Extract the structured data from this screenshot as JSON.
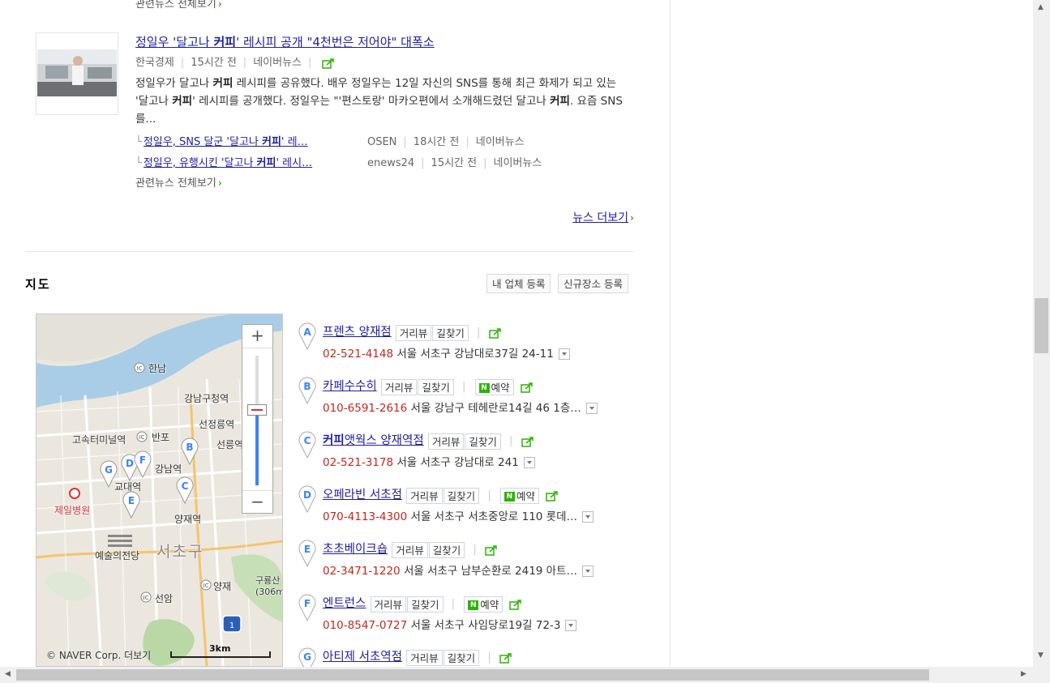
{
  "news": {
    "related_all_top": "관련뉴스 전체보기",
    "item": {
      "title_pre": "정일우 '달고나 ",
      "title_hl": "커피",
      "title_post": "' 레시피 공개 \"4천번은 저어야\" 대폭소",
      "source": "한국경제",
      "time": "15시간 전",
      "portal": "네이버뉴스",
      "desc_1": "정일우가 달고나 ",
      "desc_hl1": "커피",
      "desc_2": " 레시피를 공유했다. 배우 정일우는 12일 자신의 SNS를 통해 최근 화제가 되고 있는 '달고나 ",
      "desc_hl2": "커피",
      "desc_3": "' 레시피를 공개했다. 정일우는 \"'편스토랑' 마카오편에서 소개해드렸던 달고나 ",
      "desc_hl3": "커피",
      "desc_4": ". 요즘 SNS를...",
      "sub": [
        {
          "pre": "정일우, SNS 달군 '달고나 ",
          "hl": "커피",
          "post": "' 레…",
          "source": "OSEN",
          "time": "18시간 전",
          "portal": "네이버뉴스"
        },
        {
          "pre": "정일우, 유행시킨 '달고나 ",
          "hl": "커피",
          "post": "' 레시…",
          "source": "enews24",
          "time": "15시간 전",
          "portal": "네이버뉴스"
        }
      ],
      "related_all": "관련뉴스 전체보기"
    },
    "more_label": "뉴스 더보기"
  },
  "map_section": {
    "title": "지도",
    "btn_register_business": "내 업체 등록",
    "btn_register_place": "신규장소 등록",
    "map": {
      "labels": [
        "한남",
        "강남구청역",
        "선정릉역",
        "고속터미널역",
        "반포",
        "선릉역",
        "강남역",
        "교대역",
        "제일병원",
        "양재역",
        "예술의전당",
        "서초구",
        "양재",
        "구룡산 (306m",
        "선암"
      ],
      "zoom_in": "+",
      "zoom_out": "−",
      "copyright": "© NAVER Corp.",
      "more": "더보기",
      "scale": "3km"
    },
    "tag_street": "거리뷰",
    "tag_route": "길찾기",
    "tag_reserve": "예약",
    "places": [
      {
        "marker": "A",
        "name": "프렌츠 양재점",
        "phone": "02-521-4148",
        "address": "서울 서초구 강남대로37길 24-11",
        "reserve": false
      },
      {
        "marker": "B",
        "name": "카페수수히",
        "phone": "010-6591-2616",
        "address": "서울 강남구 테헤란로14길 46 1층…",
        "reserve": true
      },
      {
        "marker": "C",
        "name_hl": "커피",
        "name": "앳웍스 양재역점",
        "phone": "02-521-3178",
        "address": "서울 서초구 강남대로 241",
        "reserve": false
      },
      {
        "marker": "D",
        "name": "오페라빈 서초점",
        "phone": "070-4113-4300",
        "address": "서울 서초구 서초중앙로 110 롯데…",
        "reserve": true
      },
      {
        "marker": "E",
        "name": "초초베이크숍",
        "phone": "02-3471-1220",
        "address": "서울 서초구 남부순환로 2419 아트…",
        "reserve": false
      },
      {
        "marker": "F",
        "name": "엔트런스",
        "phone": "010-8547-0727",
        "address": "서울 서초구 사임당로19길 72-3",
        "reserve": true
      },
      {
        "marker": "G",
        "name": "아티제 서초역점",
        "phone": "",
        "address": "",
        "reserve": false
      }
    ]
  },
  "colors": {
    "link": "#1f1f9e",
    "phone": "#c4271c",
    "accent_green": "#2db400",
    "pin_blue": "#3b82f6"
  },
  "icons": [
    "share-icon",
    "reserve-icon",
    "pin-icon",
    "dropdown-icon",
    "chevron-right-icon"
  ]
}
